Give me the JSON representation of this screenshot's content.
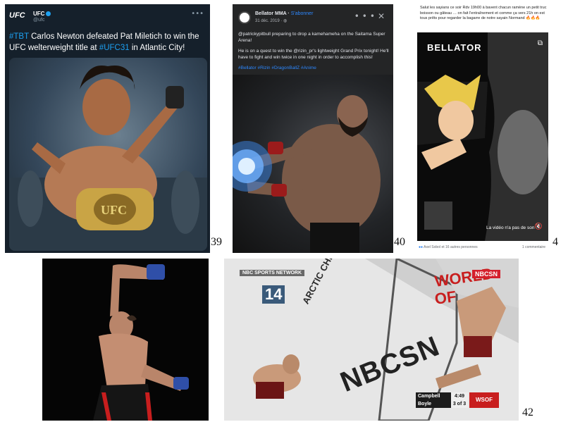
{
  "tweet": {
    "logo": "UFC",
    "account": "UFC",
    "handle": "@ufc",
    "text_pre": "",
    "tag1": "#TBT",
    "text_mid": " Carlos Newton defeated Pat Miletich to win the UFC welterweight title at ",
    "tag2": "#UFC31",
    "text_post": " in Atlantic City!"
  },
  "bellator_post": {
    "name": "Bellator MMA",
    "follow": "S'abonner",
    "date": "31 déc. 2019 · ",
    "line1": "@patrickypitbull preparing to drop a kamehameha on the Saitama Super Arena!",
    "line2": "He is on a quest to win the @rizin_pr's lightweight Grand Prix tonight! He'll have to fight and win twice in one night in order to accomplish this!",
    "hashtags": "#Bellator #Rizin #DragonBallZ #Anime"
  },
  "video_post": {
    "caption": "Salut les sayians ce soir Rdv 19h00 à bavent chacun ramène un petit truc boisson ou gâteau … on fait l'entraînement et comme ça vers 21h on est tous prêts pour regarder la bagarre de notre sayain Normand 🔥🔥🔥",
    "logo": "BELLATOR",
    "video_message": "La vidéo n'a pas de son",
    "reactions": "Axel Sobol et 16 autres personnes",
    "comments": "1 commentaire"
  },
  "broadcast": {
    "network": "NBC SPORTS NETWORK",
    "round": "14",
    "brand_side": "ARCTIC CHILLER",
    "brand_floor": "NBCSN",
    "corner_logo": "NBCSN",
    "fighter1": "Campbell",
    "fighter2": "Boyle",
    "clock": "4:49",
    "round_label": "3 of 3",
    "score_logo": "WSOF"
  },
  "figure_numbers": {
    "n39": "39",
    "n40": "40",
    "n4": "4",
    "n42": "42"
  },
  "colors": {
    "twitter_bg": "#15202b",
    "twitter_blue": "#1da1f2",
    "fb_dark": "#242526",
    "fb_link": "#2d88ff"
  }
}
